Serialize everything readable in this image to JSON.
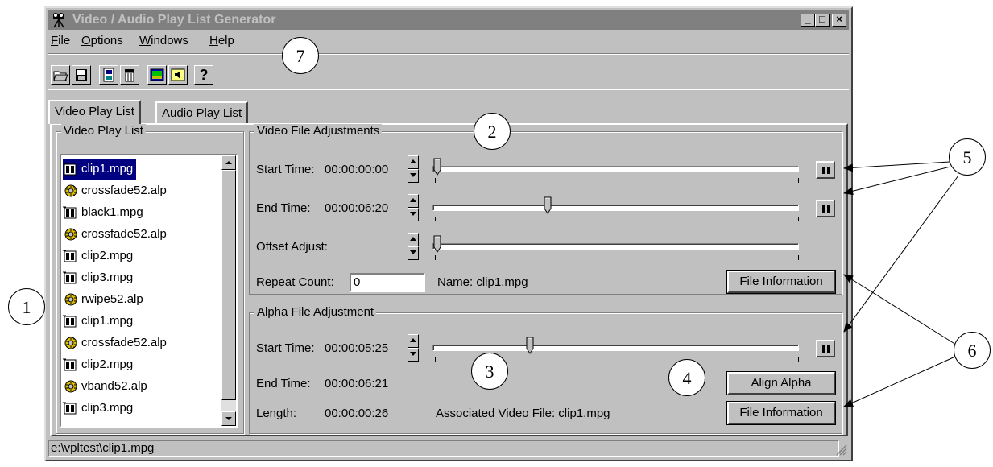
{
  "window": {
    "title": "Video / Audio Play List Generator",
    "min_label": "_",
    "max_label": "□",
    "close_label": "×"
  },
  "menu": {
    "items": [
      {
        "label": "File",
        "hotkey": "F"
      },
      {
        "label": "Options",
        "hotkey": "O"
      },
      {
        "label": "Windows",
        "hotkey": "W"
      },
      {
        "label": "Help",
        "hotkey": "H"
      }
    ]
  },
  "toolbar": {
    "tools": [
      "open-folder-icon",
      "save-icon",
      "filmstrip-icon",
      "trash-icon",
      "video-icon",
      "audio-icon",
      "help-icon"
    ],
    "help_label": "?"
  },
  "tabs": [
    {
      "label": "Video Play List",
      "active": true
    },
    {
      "label": "Audio Play List",
      "active": false
    }
  ],
  "playlist": {
    "title": "Video Play List",
    "items": [
      {
        "label": "clip1.mpg",
        "type": "video",
        "selected": true
      },
      {
        "label": "crossfade52.alp",
        "type": "alpha"
      },
      {
        "label": "black1.mpg",
        "type": "video"
      },
      {
        "label": "crossfade52.alp",
        "type": "alpha"
      },
      {
        "label": "clip2.mpg",
        "type": "video"
      },
      {
        "label": "clip3.mpg",
        "type": "video"
      },
      {
        "label": "rwipe52.alp",
        "type": "alpha"
      },
      {
        "label": "clip1.mpg",
        "type": "video"
      },
      {
        "label": "crossfade52.alp",
        "type": "alpha"
      },
      {
        "label": "clip2.mpg",
        "type": "video"
      },
      {
        "label": "vband52.alp",
        "type": "alpha"
      },
      {
        "label": "clip3.mpg",
        "type": "video"
      }
    ]
  },
  "video_adjust": {
    "title": "Video File Adjustments",
    "start_label": "Start Time:",
    "start_value": "00:00:00:00",
    "start_pos": 0.0,
    "end_label": "End Time:",
    "end_value": "00:00:06:20",
    "end_pos": 0.31,
    "offset_label": "Offset Adjust:",
    "offset_pos": 0.0,
    "repeat_label": "Repeat Count:",
    "repeat_value": "0",
    "name_label": "Name: clip1.mpg",
    "file_info_label": "File Information"
  },
  "alpha_adjust": {
    "title": "Alpha File Adjustment",
    "start_label": "Start Time:",
    "start_value": "00:00:05:25",
    "start_pos": 0.26,
    "end_label": "End Time:",
    "end_value": "00:00:06:21",
    "length_label": "Length:",
    "length_value": "00:00:00:26",
    "assoc_label": "Associated Video File: clip1.mpg",
    "align_label": "Align Alpha",
    "file_info_label": "File Information"
  },
  "statusbar": {
    "path": "e:\\vpltest\\clip1.mpg"
  },
  "callouts": [
    "1",
    "2",
    "3",
    "4",
    "5",
    "6",
    "7"
  ]
}
